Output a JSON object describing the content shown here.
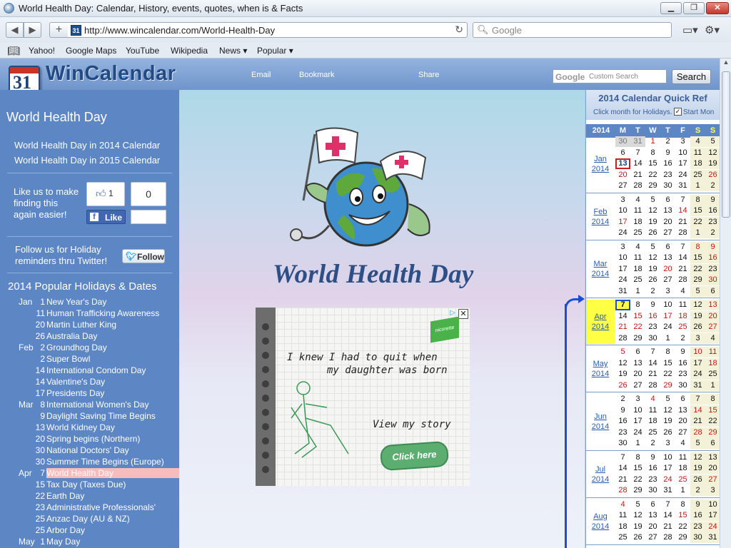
{
  "window": {
    "title": "World Health Day: Calendar, History, events, quotes, when is & Facts"
  },
  "toolbar": {
    "url": "http://www.wincalendar.com/World-Health-Day",
    "search_placeholder": "Google",
    "plus": "+"
  },
  "bookmarks": [
    "Yahoo!",
    "Google Maps",
    "YouTube",
    "Wikipedia",
    "News ▾",
    "Popular ▾"
  ],
  "header": {
    "logo_text": "WinCalendar",
    "logo_num": "31",
    "links": [
      "Email",
      "Bookmark",
      "Share"
    ],
    "search_brand": "Google",
    "search_placeholder": "Custom Search",
    "search_button": "Search"
  },
  "sidebar": {
    "heading": "World Health Day",
    "links": [
      "World Health Day in 2014 Calendar",
      "World Health Day in 2015 Calendar"
    ],
    "like_text": [
      "Like us to make",
      "finding this",
      "again easier!"
    ],
    "like_count": "1",
    "like_total": "0",
    "like_button": "Like",
    "follow_text": [
      "Follow us for Holiday",
      "reminders thru Twitter!"
    ],
    "follow_button": "Follow",
    "holidays_heading": "2014 Popular Holidays & Dates",
    "holidays": [
      {
        "m": "Jan",
        "d": "1",
        "n": "New Year's Day"
      },
      {
        "m": "",
        "d": "11",
        "n": "Human Trafficking Awareness"
      },
      {
        "m": "",
        "d": "20",
        "n": "Martin Luther King"
      },
      {
        "m": "",
        "d": "26",
        "n": "Australia Day"
      },
      {
        "m": "Feb",
        "d": "2",
        "n": "Groundhog Day"
      },
      {
        "m": "",
        "d": "2",
        "n": "Super Bowl"
      },
      {
        "m": "",
        "d": "14",
        "n": "International Condom Day"
      },
      {
        "m": "",
        "d": "14",
        "n": "Valentine's Day"
      },
      {
        "m": "",
        "d": "17",
        "n": "Presidents Day"
      },
      {
        "m": "Mar",
        "d": "8",
        "n": "International Women's Day"
      },
      {
        "m": "",
        "d": "9",
        "n": "Daylight Saving Time Begins"
      },
      {
        "m": "",
        "d": "13",
        "n": "World Kidney Day"
      },
      {
        "m": "",
        "d": "20",
        "n": "Spring begins (Northern)"
      },
      {
        "m": "",
        "d": "30",
        "n": "National Doctors' Day"
      },
      {
        "m": "",
        "d": "30",
        "n": "Summer Time Begins (Europe)"
      },
      {
        "m": "Apr",
        "d": "7",
        "n": "World Health Day",
        "sel": true
      },
      {
        "m": "",
        "d": "15",
        "n": "Tax Day (Taxes Due)"
      },
      {
        "m": "",
        "d": "22",
        "n": "Earth Day"
      },
      {
        "m": "",
        "d": "23",
        "n": "Administrative Professionals'"
      },
      {
        "m": "",
        "d": "25",
        "n": "Anzac Day (AU & NZ)"
      },
      {
        "m": "",
        "d": "25",
        "n": "Arbor Day"
      },
      {
        "m": "May",
        "d": "1",
        "n": "May Day"
      }
    ]
  },
  "main": {
    "title": "World Health Day",
    "ad": {
      "line1": "I knew I had to quit when",
      "line2": "my daughter was born",
      "line3": "View my story",
      "button": "Click here",
      "brand": "nicorette",
      "close": "✕"
    }
  },
  "quickref": {
    "title": "2014 Calendar Quick Ref",
    "subtitle": "Click month for Holidays.",
    "start_mon": "Start Mon",
    "year": "2014",
    "day_headers": [
      "M",
      "T",
      "W",
      "T",
      "F",
      "S",
      "S"
    ],
    "months": [
      {
        "name": "Jan",
        "year": "2014",
        "rows": [
          [
            "30",
            "31",
            "1",
            "2",
            "3",
            "4",
            "5"
          ],
          [
            "6",
            "7",
            "8",
            "9",
            "10",
            "11",
            "12"
          ],
          [
            "13",
            "14",
            "15",
            "16",
            "17",
            "18",
            "19"
          ],
          [
            "20",
            "21",
            "22",
            "23",
            "24",
            "25",
            "26"
          ],
          [
            "27",
            "28",
            "29",
            "30",
            "31",
            "1",
            "2"
          ]
        ]
      },
      {
        "name": "Feb",
        "year": "2014",
        "rows": [
          [
            "3",
            "4",
            "5",
            "6",
            "7",
            "8",
            "9"
          ],
          [
            "10",
            "11",
            "12",
            "13",
            "14",
            "15",
            "16"
          ],
          [
            "17",
            "18",
            "19",
            "20",
            "21",
            "22",
            "23"
          ],
          [
            "24",
            "25",
            "26",
            "27",
            "28",
            "1",
            "2"
          ]
        ]
      },
      {
        "name": "Mar",
        "year": "2014",
        "rows": [
          [
            "3",
            "4",
            "5",
            "6",
            "7",
            "8",
            "9"
          ],
          [
            "10",
            "11",
            "12",
            "13",
            "14",
            "15",
            "16"
          ],
          [
            "17",
            "18",
            "19",
            "20",
            "21",
            "22",
            "23"
          ],
          [
            "24",
            "25",
            "26",
            "27",
            "28",
            "29",
            "30"
          ],
          [
            "31",
            "1",
            "2",
            "3",
            "4",
            "5",
            "6"
          ]
        ]
      },
      {
        "name": "Apr",
        "year": "2014",
        "current": true,
        "rows": [
          [
            "7",
            "8",
            "9",
            "10",
            "11",
            "12",
            "13"
          ],
          [
            "14",
            "15",
            "16",
            "17",
            "18",
            "19",
            "20"
          ],
          [
            "21",
            "22",
            "23",
            "24",
            "25",
            "26",
            "27"
          ],
          [
            "28",
            "29",
            "30",
            "1",
            "2",
            "3",
            "4"
          ]
        ]
      },
      {
        "name": "May",
        "year": "2014",
        "rows": [
          [
            "5",
            "6",
            "7",
            "8",
            "9",
            "10",
            "11"
          ],
          [
            "12",
            "13",
            "14",
            "15",
            "16",
            "17",
            "18"
          ],
          [
            "19",
            "20",
            "21",
            "22",
            "23",
            "24",
            "25"
          ],
          [
            "26",
            "27",
            "28",
            "29",
            "30",
            "31",
            "1"
          ]
        ]
      },
      {
        "name": "Jun",
        "year": "2014",
        "rows": [
          [
            "2",
            "3",
            "4",
            "5",
            "6",
            "7",
            "8"
          ],
          [
            "9",
            "10",
            "11",
            "12",
            "13",
            "14",
            "15"
          ],
          [
            "16",
            "17",
            "18",
            "19",
            "20",
            "21",
            "22"
          ],
          [
            "23",
            "24",
            "25",
            "26",
            "27",
            "28",
            "29"
          ],
          [
            "30",
            "1",
            "2",
            "3",
            "4",
            "5",
            "6"
          ]
        ]
      },
      {
        "name": "Jul",
        "year": "2014",
        "rows": [
          [
            "7",
            "8",
            "9",
            "10",
            "11",
            "12",
            "13"
          ],
          [
            "14",
            "15",
            "16",
            "17",
            "18",
            "19",
            "20"
          ],
          [
            "21",
            "22",
            "23",
            "24",
            "25",
            "26",
            "27"
          ],
          [
            "28",
            "29",
            "30",
            "31",
            "1",
            "2",
            "3"
          ]
        ]
      },
      {
        "name": "Aug",
        "year": "2014",
        "rows": [
          [
            "4",
            "5",
            "6",
            "7",
            "8",
            "9",
            "10"
          ],
          [
            "11",
            "12",
            "13",
            "14",
            "15",
            "16",
            "17"
          ],
          [
            "18",
            "19",
            "20",
            "21",
            "22",
            "23",
            "24"
          ],
          [
            "25",
            "26",
            "27",
            "28",
            "29",
            "30",
            "31"
          ]
        ]
      }
    ],
    "red_days": {
      "Jan": [
        "1",
        "20",
        "26"
      ],
      "Feb": [
        "2",
        "14",
        "17"
      ],
      "Mar": [
        "8",
        "9",
        "16",
        "20",
        "30"
      ],
      "Apr": [
        "15",
        "16",
        "17",
        "18",
        "20",
        "21",
        "22",
        "25",
        "13",
        "27"
      ],
      "May": [
        "5",
        "11",
        "26",
        "29",
        "3",
        "10",
        "18"
      ],
      "Jun": [
        "14",
        "15",
        "28",
        "29",
        "4"
      ],
      "Jul": [
        "24",
        "25",
        "28",
        "27",
        "4",
        "1"
      ],
      "Aug": [
        "4",
        "15",
        "24"
      ]
    },
    "colors": {
      "accent": "#1a4fd0",
      "today": "#c92020",
      "selected": "#ffff44",
      "header": "#5c86c4"
    }
  }
}
